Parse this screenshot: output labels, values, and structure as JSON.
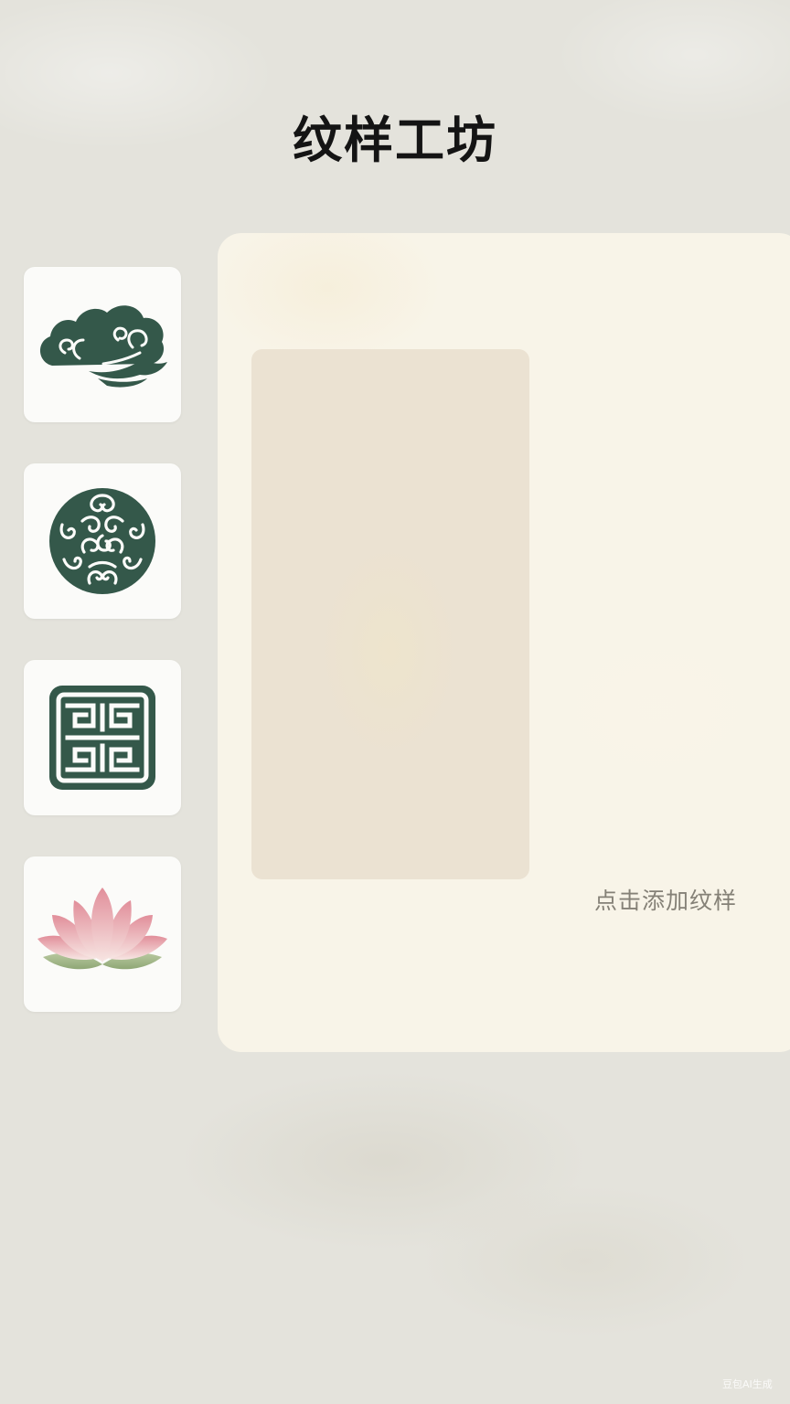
{
  "header": {
    "title": "纹样工坊"
  },
  "pattern_palette": {
    "items": [
      {
        "name": "cloud-pattern",
        "icon": "auspicious-cloud-icon",
        "color": "#34584a"
      },
      {
        "name": "round-scroll-pattern",
        "icon": "round-scroll-medallion-icon",
        "color": "#34584a"
      },
      {
        "name": "key-fret-pattern",
        "icon": "key-fret-icon",
        "color": "#34584a"
      },
      {
        "name": "lotus-pattern",
        "icon": "lotus-flower-icon",
        "color": "#d98c98"
      }
    ]
  },
  "canvas": {
    "add_hint": "点击添加纹样"
  },
  "watermark": {
    "text": "豆包AI生成"
  },
  "colors": {
    "background": "#e4e3dc",
    "panel": "#f8f4e8",
    "slot": "#ebe2d2",
    "icon_green": "#34584a",
    "hint_text": "#858177"
  }
}
